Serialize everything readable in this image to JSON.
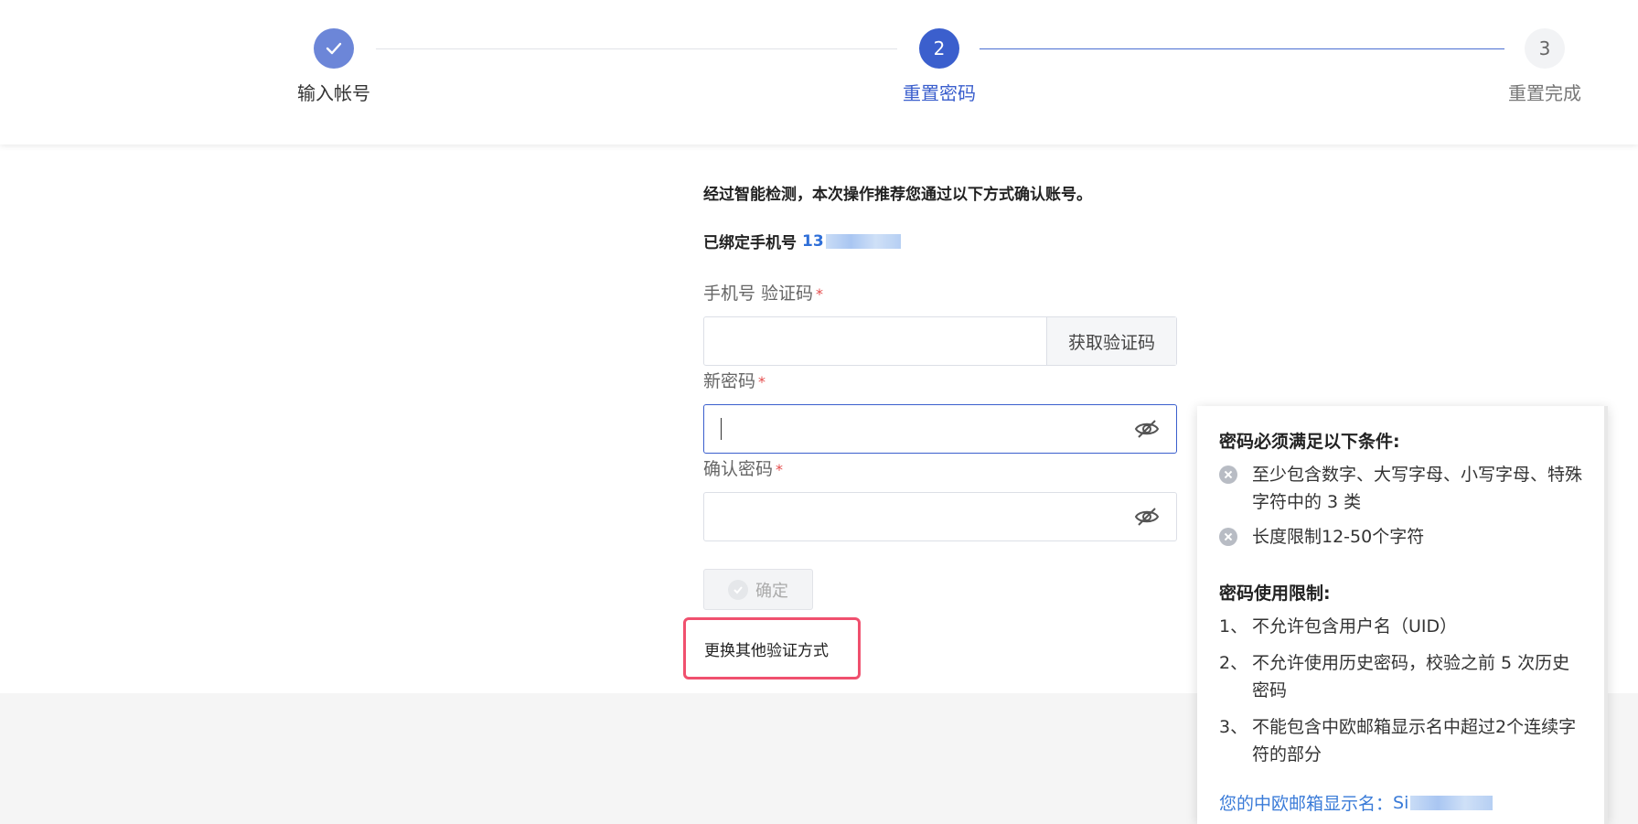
{
  "stepper": {
    "steps": [
      {
        "number": "",
        "label": "输入帐号",
        "state": "done"
      },
      {
        "number": "2",
        "label": "重置密码",
        "state": "current"
      },
      {
        "number": "3",
        "label": "重置完成",
        "state": "todo"
      }
    ]
  },
  "form": {
    "intro": "经过智能检测，本次操作推荐您通过以下方式确认账号。",
    "phone_prefix": "已绑定手机号",
    "phone_number": "13",
    "sms_code_label": "手机号 验证码",
    "get_code_button": "获取验证码",
    "new_password_label": "新密码",
    "confirm_password_label": "确认密码",
    "required_mark": "*",
    "submit_button": "确定",
    "switch_method_link": "更换其他验证方式"
  },
  "tooltip": {
    "requirements_title": "密码必须满足以下条件:",
    "requirements": [
      "至少包含数字、大写字母、小写字母、特殊字符中的 3 类",
      "长度限制12-50个字符"
    ],
    "restrictions_title": "密码使用限制:",
    "restrictions": [
      {
        "num": "1、",
        "text": "不允许包含用户名（UID）"
      },
      {
        "num": "2、",
        "text": "不允许使用历史密码，校验之前 5 次历史密码"
      },
      {
        "num": "3、",
        "text": "不能包含中欧邮箱显示名中超过2个连续字符的部分"
      }
    ],
    "display_name_label": "您的中欧邮箱显示名：",
    "display_name_value": "Si"
  },
  "colors": {
    "primary": "#3b5fcd",
    "done_step": "#6c86d8",
    "link": "#3a7bd8",
    "highlight_border": "#f0506e",
    "required": "#e54d4d"
  }
}
